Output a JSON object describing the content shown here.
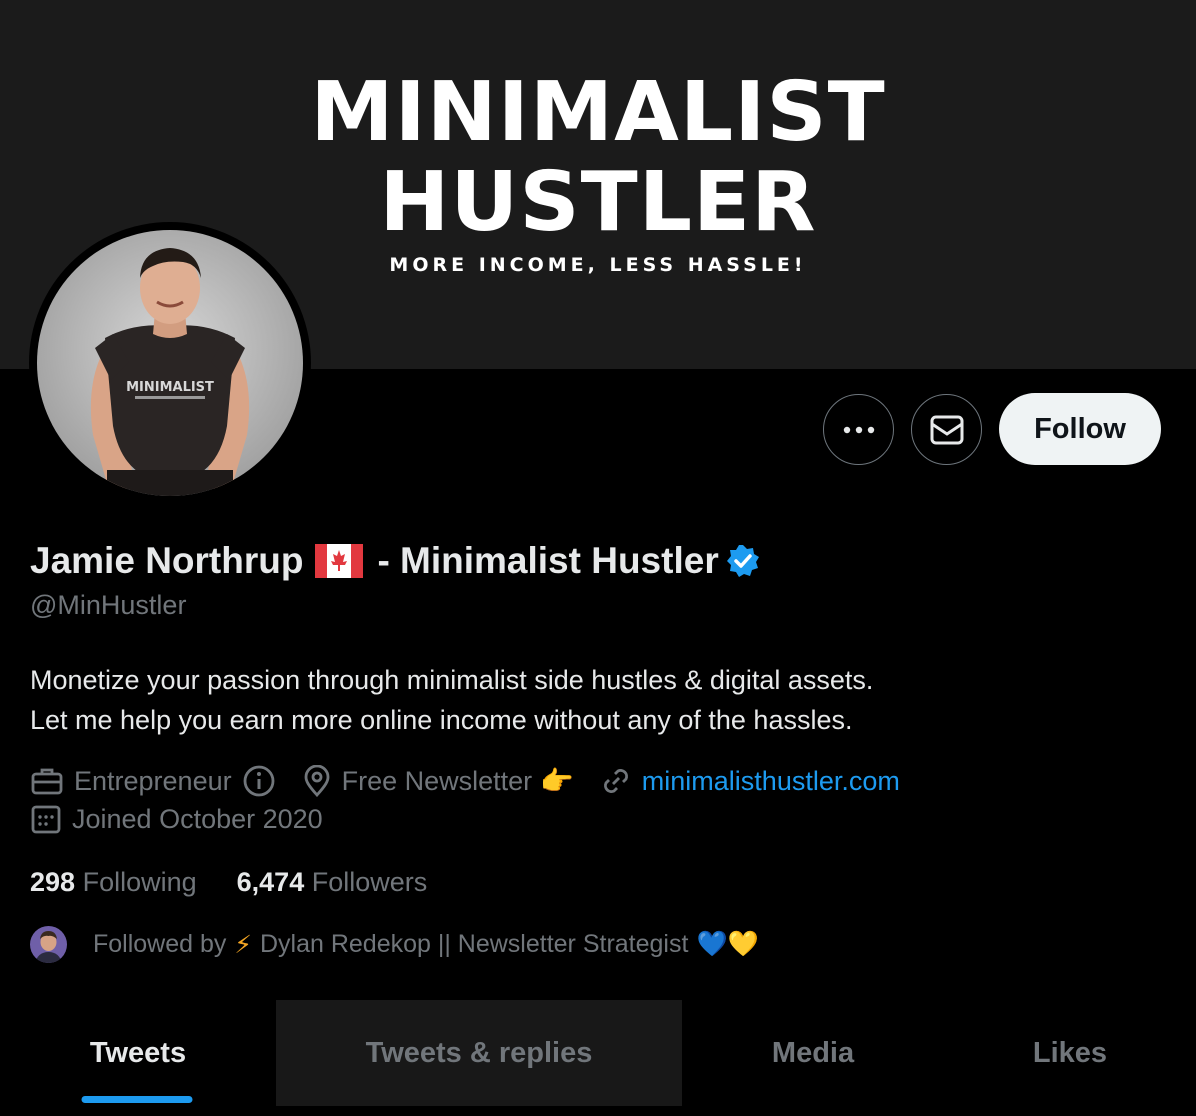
{
  "banner": {
    "title": "MINIMALIST\nHUSTLER",
    "tagline": "MORE INCOME, LESS HASSLE!"
  },
  "profile": {
    "name_part1": "Jamie Northrup",
    "name_part2": "- Minimalist Hustler",
    "flag": "🇨🇦",
    "handle": "@MinHustler",
    "bio": "Monetize your passion through minimalist side hustles & digital assets.\nLet me help you earn more online income without any of the hassles.",
    "shirt_text": "MINIMALIST"
  },
  "actions": {
    "follow_label": "Follow"
  },
  "meta": {
    "category": "Entrepreneur",
    "location": "Free Newsletter",
    "location_emoji": "👉",
    "website": "minimalisthustler.com",
    "joined": "Joined October 2020"
  },
  "stats": {
    "following_count": "298",
    "following_label": "Following",
    "followers_count": "6,474",
    "followers_label": "Followers"
  },
  "followed_by": {
    "prefix": "Followed by",
    "emoji": "⚡",
    "name": "Dylan Redekop || Newsletter Strategist",
    "hearts": "💙💛"
  },
  "tabs": [
    {
      "label": "Tweets"
    },
    {
      "label": "Tweets & replies"
    },
    {
      "label": "Media"
    },
    {
      "label": "Likes"
    }
  ],
  "colors": {
    "accent": "#1d9bf0",
    "verified": "#1d9bf0",
    "muted_text": "#71767b",
    "banner_bg": "#1b1b1b"
  }
}
